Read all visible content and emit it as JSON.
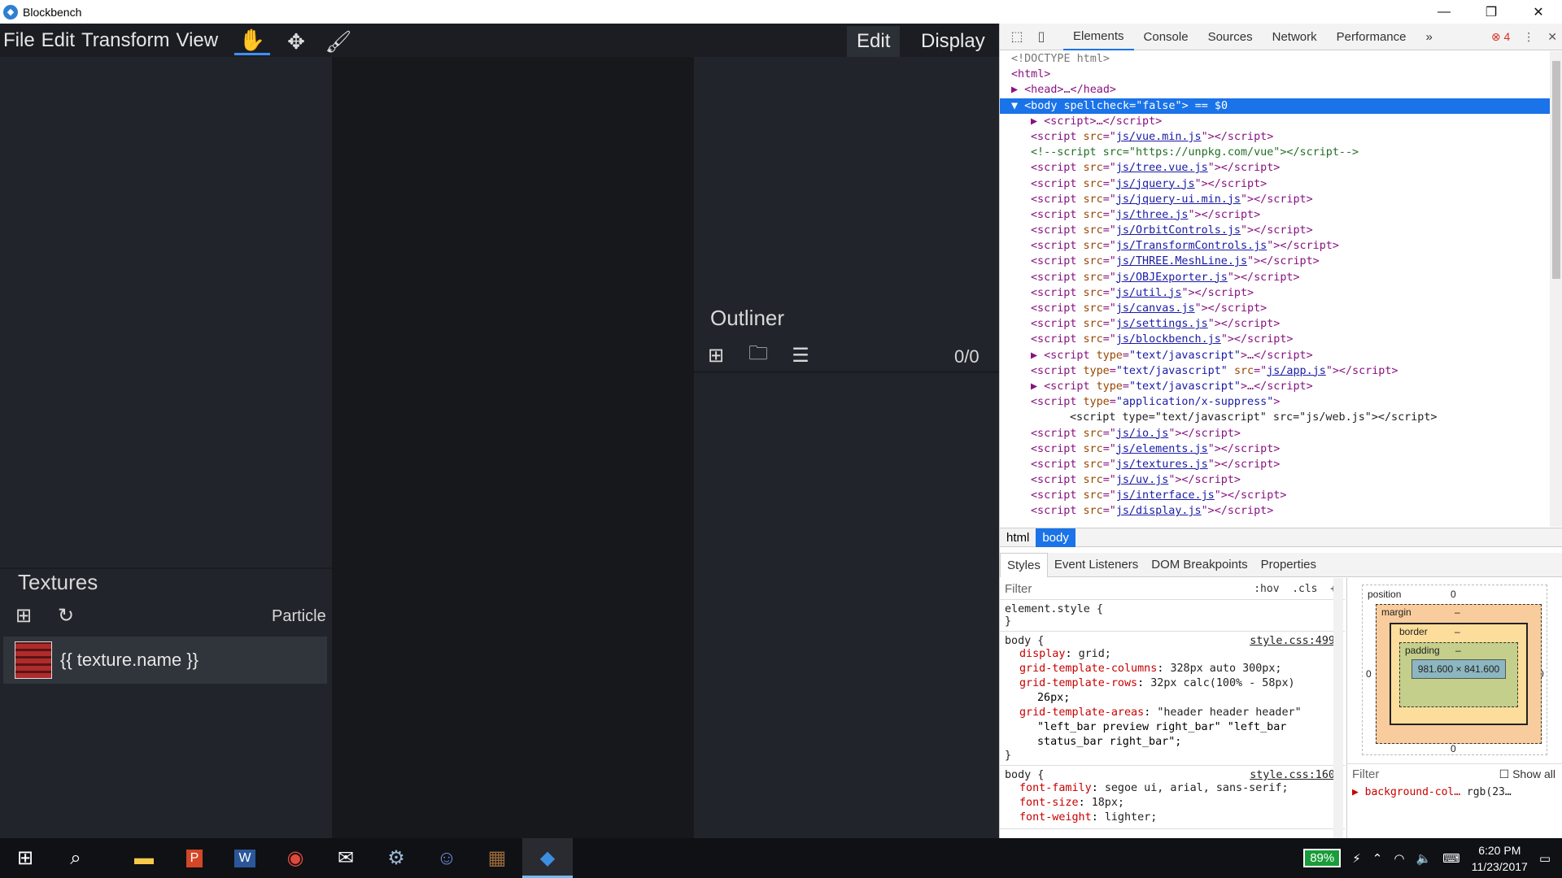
{
  "window": {
    "title": "Blockbench"
  },
  "menu": [
    "File",
    "Edit",
    "Transform",
    "View"
  ],
  "modes": {
    "edit": "Edit",
    "display": "Display"
  },
  "outliner": {
    "title": "Outliner",
    "count": "0/0"
  },
  "textures": {
    "title": "Textures",
    "particle_label": "Particle",
    "item_name": "{{ texture.name }}"
  },
  "devtools": {
    "tabs": [
      "Elements",
      "Console",
      "Sources",
      "Network",
      "Performance"
    ],
    "error_count": "4",
    "breadcrumbs": [
      "html",
      "body"
    ],
    "sub_tabs": [
      "Styles",
      "Event Listeners",
      "DOM Breakpoints",
      "Properties"
    ],
    "filter_placeholder": "Filter",
    "hov": ":hov",
    "cls": ".cls",
    "element_style": "element.style {",
    "rules": [
      {
        "selector": "body {",
        "source": "style.css:499",
        "decls": [
          [
            "display",
            "grid;"
          ],
          [
            "grid-template-columns",
            "328px auto 300px;"
          ],
          [
            "grid-template-rows",
            "32px calc(100% - 58px)"
          ],
          [
            "",
            "26px;"
          ],
          [
            "grid-template-areas",
            "\"header header header\""
          ],
          [
            "",
            "\"left_bar preview right_bar\" \"left_bar"
          ],
          [
            "",
            "status_bar right_bar\";"
          ]
        ]
      },
      {
        "selector": "body {",
        "source": "style.css:160",
        "decls": [
          [
            "font-family",
            "segoe ui, arial, sans-serif;"
          ],
          [
            "font-size",
            "18px;"
          ],
          [
            "font-weight",
            "lighter;"
          ]
        ]
      }
    ],
    "box_model": {
      "position_label": "position",
      "margin_label": "margin",
      "border_label": "border",
      "padding_label": "padding",
      "content": "981.600 × 841.600",
      "zero": "0",
      "dash": "–"
    },
    "computed": {
      "filter": "Filter",
      "show_all": "Show all",
      "prop": "background-col…",
      "value": "rgb(23…"
    },
    "dom_lines": [
      {
        "indent": 0,
        "html": "<span class='gray'>&lt;!DOCTYPE html&gt;</span>"
      },
      {
        "indent": 0,
        "html": "&lt;html&gt;"
      },
      {
        "indent": 0,
        "html": "▶ &lt;head&gt;…&lt;/head&gt;"
      },
      {
        "indent": 0,
        "html": "▼ &lt;body <span class='attr'>spellcheck</span>=<span class='val'>\"false\"</span>&gt; <span class='gray'>== $0</span>",
        "selected": true
      },
      {
        "indent": 1,
        "html": "▶ &lt;script&gt;…&lt;/script&gt;"
      },
      {
        "indent": 1,
        "html": "&lt;script <span class='attr'>src</span>=\"<span class='link'>js/vue.min.js</span>\"&gt;&lt;/script&gt;"
      },
      {
        "indent": 1,
        "html": "<span class='comment'>&lt;!--script src=\"https://unpkg.com/vue\"&gt;&lt;/script--&gt;</span>"
      },
      {
        "indent": 1,
        "html": "&lt;script <span class='attr'>src</span>=\"<span class='link'>js/tree.vue.js</span>\"&gt;&lt;/script&gt;"
      },
      {
        "indent": 1,
        "html": "&lt;script <span class='attr'>src</span>=\"<span class='link'>js/jquery.js</span>\"&gt;&lt;/script&gt;"
      },
      {
        "indent": 1,
        "html": "&lt;script <span class='attr'>src</span>=\"<span class='link'>js/jquery-ui.min.js</span>\"&gt;&lt;/script&gt;"
      },
      {
        "indent": 1,
        "html": "&lt;script <span class='attr'>src</span>=\"<span class='link'>js/three.js</span>\"&gt;&lt;/script&gt;"
      },
      {
        "indent": 1,
        "html": "&lt;script <span class='attr'>src</span>=\"<span class='link'>js/OrbitControls.js</span>\"&gt;&lt;/script&gt;"
      },
      {
        "indent": 1,
        "html": "&lt;script <span class='attr'>src</span>=\"<span class='link'>js/TransformControls.js</span>\"&gt;&lt;/script&gt;"
      },
      {
        "indent": 1,
        "html": "&lt;script <span class='attr'>src</span>=\"<span class='link'>js/THREE.MeshLine.js</span>\"&gt;&lt;/script&gt;"
      },
      {
        "indent": 1,
        "html": "&lt;script <span class='attr'>src</span>=\"<span class='link'>js/OBJExporter.js</span>\"&gt;&lt;/script&gt;"
      },
      {
        "indent": 1,
        "html": "&lt;script <span class='attr'>src</span>=\"<span class='link'>js/util.js</span>\"&gt;&lt;/script&gt;"
      },
      {
        "indent": 1,
        "html": "&lt;script <span class='attr'>src</span>=\"<span class='link'>js/canvas.js</span>\"&gt;&lt;/script&gt;"
      },
      {
        "indent": 1,
        "html": "&lt;script <span class='attr'>src</span>=\"<span class='link'>js/settings.js</span>\"&gt;&lt;/script&gt;"
      },
      {
        "indent": 1,
        "html": "&lt;script <span class='attr'>src</span>=\"<span class='link'>js/blockbench.js</span>\"&gt;&lt;/script&gt;"
      },
      {
        "indent": 1,
        "html": "▶ &lt;script <span class='attr'>type</span>=<span class='val'>\"text/javascript\"</span>&gt;…&lt;/script&gt;"
      },
      {
        "indent": 1,
        "html": "&lt;script <span class='attr'>type</span>=<span class='val'>\"text/javascript\"</span> <span class='attr'>src</span>=\"<span class='link'>js/app.js</span>\"&gt;&lt;/script&gt;"
      },
      {
        "indent": 1,
        "html": "▶ &lt;script <span class='attr'>type</span>=<span class='val'>\"text/javascript\"</span>&gt;…&lt;/script&gt;"
      },
      {
        "indent": 1,
        "html": "&lt;script <span class='attr'>type</span>=<span class='val'>\"application/x-suppress\"</span>&gt;"
      },
      {
        "indent": 3,
        "html": "<span class='gray' style='color:#222'>&lt;script type=\"text/javascript\" src=\"js/web.js\"&gt;&lt;/script&gt;</span>"
      },
      {
        "indent": 1,
        "html": "&lt;script <span class='attr'>src</span>=\"<span class='link'>js/io.js</span>\"&gt;&lt;/script&gt;"
      },
      {
        "indent": 1,
        "html": "&lt;script <span class='attr'>src</span>=\"<span class='link'>js/elements.js</span>\"&gt;&lt;/script&gt;"
      },
      {
        "indent": 1,
        "html": "&lt;script <span class='attr'>src</span>=\"<span class='link'>js/textures.js</span>\"&gt;&lt;/script&gt;"
      },
      {
        "indent": 1,
        "html": "&lt;script <span class='attr'>src</span>=\"<span class='link'>js/uv.js</span>\"&gt;&lt;/script&gt;"
      },
      {
        "indent": 1,
        "html": "&lt;script <span class='attr'>src</span>=\"<span class='link'>js/interface.js</span>\"&gt;&lt;/script&gt;"
      },
      {
        "indent": 1,
        "html": "&lt;script <span class='attr'>src</span>=\"<span class='link'>js/display.js</span>\"&gt;&lt;/script&gt;"
      }
    ]
  },
  "taskbar": {
    "battery": "89%",
    "time": "6:20 PM",
    "date": "11/23/2017",
    "apps": [
      "explorer-icon",
      "powerpoint-icon",
      "word-icon",
      "chrome-icon",
      "mail-icon",
      "steam-icon",
      "discord-icon",
      "minecraft-icon",
      "blockbench-icon"
    ]
  }
}
